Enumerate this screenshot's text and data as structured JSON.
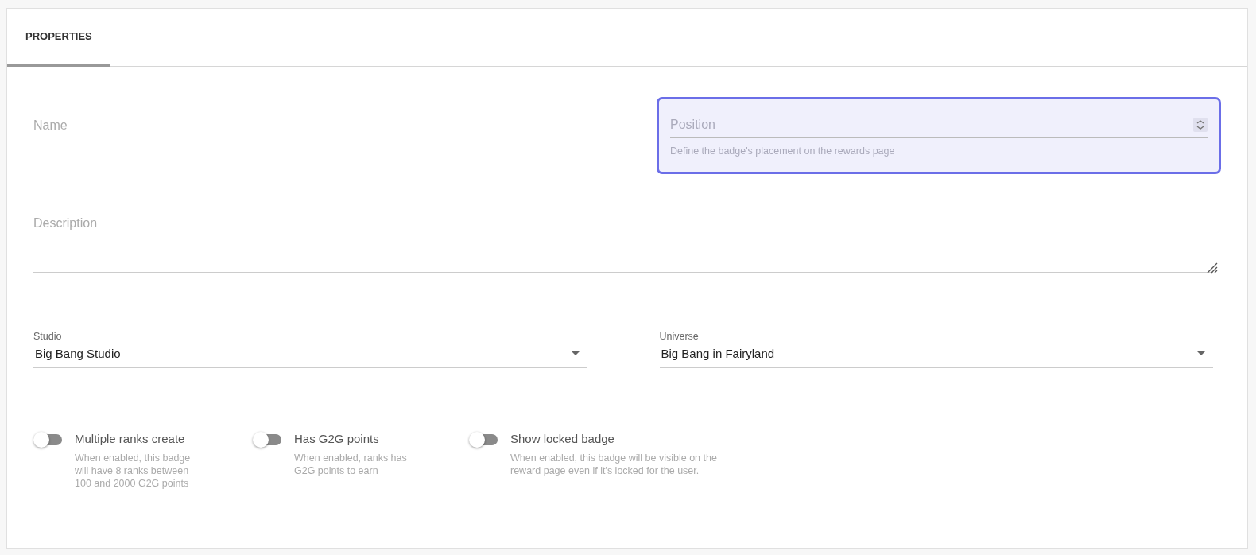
{
  "tabs": [
    {
      "label": "PROPERTIES",
      "selected": true
    }
  ],
  "name_field": {
    "placeholder": "Name"
  },
  "position_field": {
    "placeholder": "Position",
    "helper": "Define the badge's placement on the rewards page",
    "focused": true
  },
  "description_field": {
    "placeholder": "Description"
  },
  "selects": [
    {
      "label": "Studio",
      "value": "Big Bang Studio"
    },
    {
      "label": "Universe",
      "value": "Big Bang in Fairyland"
    }
  ],
  "toggles": [
    {
      "label": "Multiple ranks create",
      "hint": "When enabled, this badge will have 8 ranks between 100 and 2000 G2G points",
      "on": false
    },
    {
      "label": "Has G2G points",
      "hint": "When enabled, ranks has G2G points to earn",
      "on": false
    },
    {
      "label": "Show locked badge",
      "hint": "When enabled, this badge will be visible on the reward page even if it's locked for the user.",
      "on": false
    }
  ]
}
